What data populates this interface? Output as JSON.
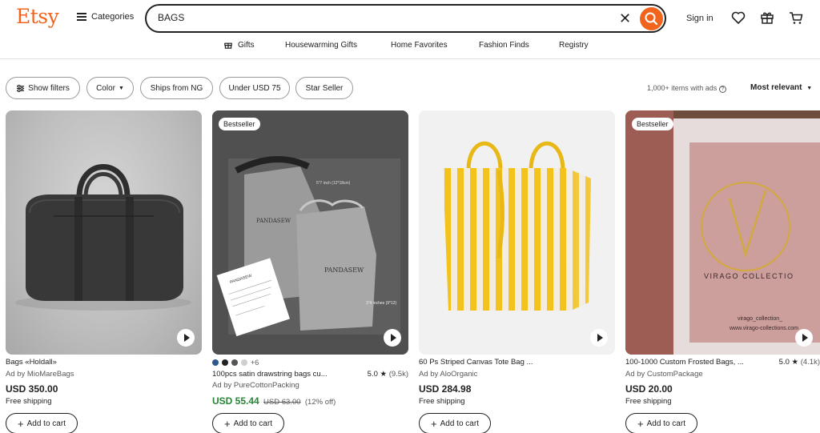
{
  "header": {
    "logo": "Etsy",
    "categories_label": "Categories",
    "search_value": "BAGS",
    "signin_label": "Sign in"
  },
  "subnav": [
    "Gifts",
    "Housewarming Gifts",
    "Home Favorites",
    "Fashion Finds",
    "Registry"
  ],
  "filters": {
    "show_filters": "Show filters",
    "color": "Color",
    "ships_from": "Ships from NG",
    "under": "Under USD 75",
    "star_seller": "Star Seller",
    "results": "1,000+ items with ads",
    "sort": "Most relevant"
  },
  "products": [
    {
      "title": "Bags «Holdall»",
      "ad_by": "Ad by MioMareBags",
      "price": "USD 350.00",
      "shipping": "Free shipping",
      "cart": "Add to cart"
    },
    {
      "badge": "Bestseller",
      "title": "100pcs satin drawstring bags cu...",
      "rating": "5.0",
      "reviews": "(9.5k)",
      "ad_by": "Ad by PureCottonPacking",
      "price": "USD 55.44",
      "original_price": "USD 63.00",
      "discount": "(12% off)",
      "more_colors": "+6",
      "pouch_brand": "PANDASEW",
      "pouch_size_1": "5\"7 inch (12*18cm)",
      "pouch_size_2": "3\"4 inches (9*12)",
      "cart": "Add to cart"
    },
    {
      "title": "60 Ps Striped Canvas Tote Bag ...",
      "ad_by": "Ad by AloOrganic",
      "price": "USD 284.98",
      "shipping": "Free shipping",
      "cart": "Add to cart"
    },
    {
      "badge": "Bestseller",
      "title": "100-1000 Custom Frosted Bags, ...",
      "rating": "5.0",
      "reviews": "(4.1k)",
      "ad_by": "Ad by CustomPackage",
      "price": "USD 20.00",
      "shipping": "Free shipping",
      "bag_brand": "VIRAGO COLLECTIO",
      "bag_handle": "virago_collection_",
      "bag_url": "www.virago-collections.com",
      "cart": "Add to cart"
    }
  ],
  "colors": {
    "brand": "#f1641e",
    "sale": "#258635",
    "swatches": [
      "#2b5a8a",
      "#222222",
      "#555555",
      "#cfcfcf"
    ]
  }
}
